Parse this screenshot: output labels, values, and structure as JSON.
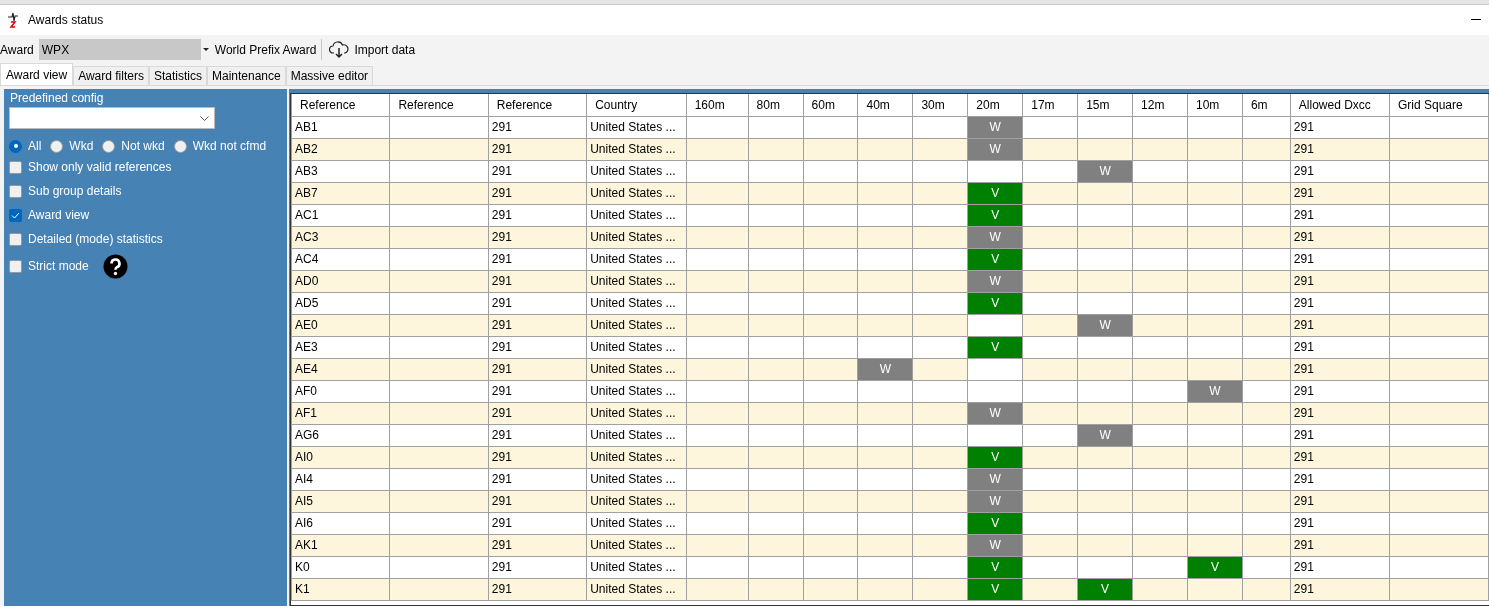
{
  "window": {
    "title": "Awards status"
  },
  "toolbar": {
    "award_label": "Award",
    "award_value": "WPX",
    "award_name": "World Prefix Award",
    "import_button": "Import data"
  },
  "tabs": [
    {
      "label": "Award view",
      "selected": true
    },
    {
      "label": "Award filters",
      "selected": false
    },
    {
      "label": "Statistics",
      "selected": false
    },
    {
      "label": "Maintenance",
      "selected": false
    },
    {
      "label": "Massive editor",
      "selected": false
    }
  ],
  "sidebar": {
    "predefined_config_label": "Predefined config",
    "radios": [
      {
        "label": "All",
        "selected": true
      },
      {
        "label": "Wkd",
        "selected": false
      },
      {
        "label": "Not wkd",
        "selected": false
      },
      {
        "label": "Wkd not cfmd",
        "selected": false
      }
    ],
    "checkboxes": [
      {
        "label": "Show only valid references",
        "checked": false
      },
      {
        "label": "Sub group details",
        "checked": false
      },
      {
        "label": "Award view",
        "checked": true
      },
      {
        "label": "Detailed (mode) statistics",
        "checked": false
      },
      {
        "label": "Strict mode",
        "checked": false,
        "help": true
      }
    ]
  },
  "table": {
    "columns": [
      "Reference",
      "Reference",
      "Reference",
      "Country",
      "160m",
      "80m",
      "60m",
      "40m",
      "30m",
      "20m",
      "17m",
      "15m",
      "12m",
      "10m",
      "6m",
      "Allowed Dxcc",
      "Grid Square"
    ],
    "rows": [
      {
        "reference": "AB1",
        "reference_3": "291",
        "country": "United States ...",
        "allowed_dxcc": "291",
        "bands": [
          {
            "kind": "empty"
          },
          {
            "kind": "empty"
          },
          {
            "kind": "empty"
          },
          {
            "kind": "empty"
          },
          {
            "kind": "empty"
          },
          {
            "text": "W",
            "kind": "worked"
          },
          {
            "kind": "empty"
          },
          {
            "kind": "empty"
          },
          {
            "kind": "empty"
          },
          {
            "kind": "empty"
          },
          {
            "kind": "empty"
          }
        ]
      },
      {
        "reference": "AB2",
        "reference_3": "291",
        "country": "United States ...",
        "allowed_dxcc": "291",
        "bands": [
          {
            "kind": "empty"
          },
          {
            "kind": "empty"
          },
          {
            "kind": "empty"
          },
          {
            "kind": "empty"
          },
          {
            "kind": "empty"
          },
          {
            "text": "W",
            "kind": "worked"
          },
          {
            "kind": "empty"
          },
          {
            "kind": "empty"
          },
          {
            "kind": "empty"
          },
          {
            "kind": "empty"
          },
          {
            "kind": "empty"
          }
        ]
      },
      {
        "reference": "AB3",
        "reference_3": "291",
        "country": "United States ...",
        "allowed_dxcc": "291",
        "bands": [
          {
            "kind": "empty"
          },
          {
            "kind": "empty"
          },
          {
            "kind": "empty"
          },
          {
            "kind": "empty"
          },
          {
            "kind": "empty"
          },
          {
            "kind": "empty"
          },
          {
            "kind": "empty"
          },
          {
            "text": "W",
            "kind": "worked"
          },
          {
            "kind": "empty"
          },
          {
            "kind": "empty"
          },
          {
            "kind": "empty"
          }
        ]
      },
      {
        "reference": "AB7",
        "reference_3": "291",
        "country": "United States ...",
        "allowed_dxcc": "291",
        "bands": [
          {
            "kind": "empty"
          },
          {
            "kind": "empty"
          },
          {
            "kind": "empty"
          },
          {
            "kind": "empty"
          },
          {
            "kind": "empty"
          },
          {
            "text": "V",
            "kind": "validated"
          },
          {
            "kind": "empty"
          },
          {
            "kind": "empty"
          },
          {
            "kind": "empty"
          },
          {
            "kind": "empty"
          },
          {
            "kind": "empty"
          }
        ]
      },
      {
        "reference": "AC1",
        "reference_3": "291",
        "country": "United States ...",
        "allowed_dxcc": "291",
        "bands": [
          {
            "kind": "empty"
          },
          {
            "kind": "empty"
          },
          {
            "kind": "empty"
          },
          {
            "kind": "empty"
          },
          {
            "kind": "empty"
          },
          {
            "text": "V",
            "kind": "validated"
          },
          {
            "kind": "empty"
          },
          {
            "kind": "empty"
          },
          {
            "kind": "empty"
          },
          {
            "kind": "empty"
          },
          {
            "kind": "empty"
          }
        ]
      },
      {
        "reference": "AC3",
        "reference_3": "291",
        "country": "United States ...",
        "allowed_dxcc": "291",
        "bands": [
          {
            "kind": "empty"
          },
          {
            "kind": "empty"
          },
          {
            "kind": "empty"
          },
          {
            "kind": "empty"
          },
          {
            "kind": "empty"
          },
          {
            "text": "W",
            "kind": "worked"
          },
          {
            "kind": "empty"
          },
          {
            "kind": "empty"
          },
          {
            "kind": "empty"
          },
          {
            "kind": "empty"
          },
          {
            "kind": "empty"
          }
        ]
      },
      {
        "reference": "AC4",
        "reference_3": "291",
        "country": "United States ...",
        "allowed_dxcc": "291",
        "bands": [
          {
            "kind": "empty"
          },
          {
            "kind": "empty"
          },
          {
            "kind": "empty"
          },
          {
            "kind": "empty"
          },
          {
            "kind": "empty"
          },
          {
            "text": "V",
            "kind": "validated"
          },
          {
            "kind": "empty"
          },
          {
            "kind": "empty"
          },
          {
            "kind": "empty"
          },
          {
            "kind": "empty"
          },
          {
            "kind": "empty"
          }
        ]
      },
      {
        "reference": "AD0",
        "reference_3": "291",
        "country": "United States ...",
        "allowed_dxcc": "291",
        "bands": [
          {
            "kind": "empty"
          },
          {
            "kind": "empty"
          },
          {
            "kind": "empty"
          },
          {
            "kind": "empty"
          },
          {
            "kind": "empty"
          },
          {
            "text": "W",
            "kind": "worked"
          },
          {
            "kind": "empty"
          },
          {
            "kind": "empty"
          },
          {
            "kind": "empty"
          },
          {
            "kind": "empty"
          },
          {
            "kind": "empty"
          }
        ]
      },
      {
        "reference": "AD5",
        "reference_3": "291",
        "country": "United States ...",
        "allowed_dxcc": "291",
        "bands": [
          {
            "kind": "empty"
          },
          {
            "kind": "empty"
          },
          {
            "kind": "empty"
          },
          {
            "kind": "empty"
          },
          {
            "kind": "empty"
          },
          {
            "text": "V",
            "kind": "validated"
          },
          {
            "kind": "empty"
          },
          {
            "kind": "empty"
          },
          {
            "kind": "empty"
          },
          {
            "kind": "empty"
          },
          {
            "kind": "empty"
          }
        ]
      },
      {
        "reference": "AE0",
        "reference_3": "291",
        "country": "United States ...",
        "allowed_dxcc": "291",
        "bands": [
          {
            "kind": "empty"
          },
          {
            "kind": "empty"
          },
          {
            "kind": "empty"
          },
          {
            "kind": "empty"
          },
          {
            "kind": "empty"
          },
          {
            "kind": "empty"
          },
          {
            "kind": "empty"
          },
          {
            "text": "W",
            "kind": "worked"
          },
          {
            "kind": "empty"
          },
          {
            "kind": "empty"
          },
          {
            "kind": "empty"
          }
        ]
      },
      {
        "reference": "AE3",
        "reference_3": "291",
        "country": "United States ...",
        "allowed_dxcc": "291",
        "bands": [
          {
            "kind": "empty"
          },
          {
            "kind": "empty"
          },
          {
            "kind": "empty"
          },
          {
            "kind": "empty"
          },
          {
            "kind": "empty"
          },
          {
            "text": "V",
            "kind": "validated"
          },
          {
            "kind": "empty"
          },
          {
            "kind": "empty"
          },
          {
            "kind": "empty"
          },
          {
            "kind": "empty"
          },
          {
            "kind": "empty"
          }
        ]
      },
      {
        "reference": "AE4",
        "reference_3": "291",
        "country": "United States ...",
        "allowed_dxcc": "291",
        "bands": [
          {
            "kind": "empty"
          },
          {
            "kind": "empty"
          },
          {
            "kind": "empty"
          },
          {
            "text": "W",
            "kind": "worked"
          },
          {
            "kind": "empty"
          },
          {
            "kind": "empty"
          },
          {
            "kind": "empty"
          },
          {
            "kind": "empty"
          },
          {
            "kind": "empty"
          },
          {
            "kind": "empty"
          },
          {
            "kind": "empty"
          }
        ]
      },
      {
        "reference": "AF0",
        "reference_3": "291",
        "country": "United States ...",
        "allowed_dxcc": "291",
        "bands": [
          {
            "kind": "empty"
          },
          {
            "kind": "empty"
          },
          {
            "kind": "empty"
          },
          {
            "kind": "empty"
          },
          {
            "kind": "empty"
          },
          {
            "kind": "empty"
          },
          {
            "kind": "empty"
          },
          {
            "kind": "empty"
          },
          {
            "kind": "empty"
          },
          {
            "text": "W",
            "kind": "worked"
          },
          {
            "kind": "empty"
          }
        ]
      },
      {
        "reference": "AF1",
        "reference_3": "291",
        "country": "United States ...",
        "allowed_dxcc": "291",
        "bands": [
          {
            "kind": "empty"
          },
          {
            "kind": "empty"
          },
          {
            "kind": "empty"
          },
          {
            "kind": "empty"
          },
          {
            "kind": "empty"
          },
          {
            "text": "W",
            "kind": "worked"
          },
          {
            "kind": "empty"
          },
          {
            "kind": "empty"
          },
          {
            "kind": "empty"
          },
          {
            "kind": "empty"
          },
          {
            "kind": "empty"
          }
        ]
      },
      {
        "reference": "AG6",
        "reference_3": "291",
        "country": "United States ...",
        "allowed_dxcc": "291",
        "bands": [
          {
            "kind": "empty"
          },
          {
            "kind": "empty"
          },
          {
            "kind": "empty"
          },
          {
            "kind": "empty"
          },
          {
            "kind": "empty"
          },
          {
            "kind": "empty"
          },
          {
            "kind": "empty"
          },
          {
            "text": "W",
            "kind": "worked"
          },
          {
            "kind": "empty"
          },
          {
            "kind": "empty"
          },
          {
            "kind": "empty"
          }
        ]
      },
      {
        "reference": "AI0",
        "reference_3": "291",
        "country": "United States ...",
        "allowed_dxcc": "291",
        "bands": [
          {
            "kind": "empty"
          },
          {
            "kind": "empty"
          },
          {
            "kind": "empty"
          },
          {
            "kind": "empty"
          },
          {
            "kind": "empty"
          },
          {
            "text": "V",
            "kind": "validated"
          },
          {
            "kind": "empty"
          },
          {
            "kind": "empty"
          },
          {
            "kind": "empty"
          },
          {
            "kind": "empty"
          },
          {
            "kind": "empty"
          }
        ]
      },
      {
        "reference": "AI4",
        "reference_3": "291",
        "country": "United States ...",
        "allowed_dxcc": "291",
        "bands": [
          {
            "kind": "empty"
          },
          {
            "kind": "empty"
          },
          {
            "kind": "empty"
          },
          {
            "kind": "empty"
          },
          {
            "kind": "empty"
          },
          {
            "text": "W",
            "kind": "worked"
          },
          {
            "kind": "empty"
          },
          {
            "kind": "empty"
          },
          {
            "kind": "empty"
          },
          {
            "kind": "empty"
          },
          {
            "kind": "empty"
          }
        ]
      },
      {
        "reference": "AI5",
        "reference_3": "291",
        "country": "United States ...",
        "allowed_dxcc": "291",
        "bands": [
          {
            "kind": "empty"
          },
          {
            "kind": "empty"
          },
          {
            "kind": "empty"
          },
          {
            "kind": "empty"
          },
          {
            "kind": "empty"
          },
          {
            "text": "W",
            "kind": "worked"
          },
          {
            "kind": "empty"
          },
          {
            "kind": "empty"
          },
          {
            "kind": "empty"
          },
          {
            "kind": "empty"
          },
          {
            "kind": "empty"
          }
        ]
      },
      {
        "reference": "AI6",
        "reference_3": "291",
        "country": "United States ...",
        "allowed_dxcc": "291",
        "bands": [
          {
            "kind": "empty"
          },
          {
            "kind": "empty"
          },
          {
            "kind": "empty"
          },
          {
            "kind": "empty"
          },
          {
            "kind": "empty"
          },
          {
            "text": "V",
            "kind": "validated"
          },
          {
            "kind": "empty"
          },
          {
            "kind": "empty"
          },
          {
            "kind": "empty"
          },
          {
            "kind": "empty"
          },
          {
            "kind": "empty"
          }
        ]
      },
      {
        "reference": "AK1",
        "reference_3": "291",
        "country": "United States ...",
        "allowed_dxcc": "291",
        "bands": [
          {
            "kind": "empty"
          },
          {
            "kind": "empty"
          },
          {
            "kind": "empty"
          },
          {
            "kind": "empty"
          },
          {
            "kind": "empty"
          },
          {
            "text": "W",
            "kind": "worked"
          },
          {
            "kind": "empty"
          },
          {
            "kind": "empty"
          },
          {
            "kind": "empty"
          },
          {
            "kind": "empty"
          },
          {
            "kind": "empty"
          }
        ]
      },
      {
        "reference": "K0",
        "reference_3": "291",
        "country": "United States ...",
        "allowed_dxcc": "291",
        "bands": [
          {
            "kind": "empty"
          },
          {
            "kind": "empty"
          },
          {
            "kind": "empty"
          },
          {
            "kind": "empty"
          },
          {
            "kind": "empty"
          },
          {
            "text": "V",
            "kind": "validated"
          },
          {
            "kind": "empty"
          },
          {
            "kind": "empty"
          },
          {
            "kind": "empty"
          },
          {
            "text": "V",
            "kind": "validated"
          },
          {
            "kind": "empty"
          }
        ]
      },
      {
        "reference": "K1",
        "reference_3": "291",
        "country": "United States ...",
        "allowed_dxcc": "291",
        "bands": [
          {
            "kind": "empty"
          },
          {
            "kind": "empty"
          },
          {
            "kind": "empty"
          },
          {
            "kind": "empty"
          },
          {
            "kind": "empty"
          },
          {
            "text": "V",
            "kind": "validated"
          },
          {
            "kind": "empty"
          },
          {
            "text": "V",
            "kind": "validated"
          },
          {
            "kind": "empty"
          },
          {
            "kind": "empty"
          },
          {
            "kind": "empty"
          }
        ]
      }
    ]
  }
}
